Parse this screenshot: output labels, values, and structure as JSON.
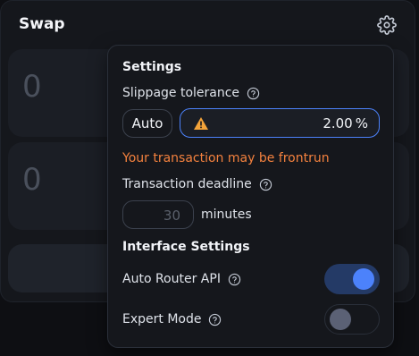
{
  "swap": {
    "title": "Swap",
    "input_amount": "0",
    "output_amount": "0"
  },
  "settings": {
    "title": "Settings",
    "slippage_label": "Slippage tolerance",
    "auto_label": "Auto",
    "slippage_value": "2.00",
    "slippage_unit": "%",
    "frontrun_warning": "Your transaction may be frontrun",
    "deadline_label": "Transaction deadline",
    "deadline_placeholder": "30",
    "deadline_unit": "minutes",
    "interface_title": "Interface Settings",
    "auto_router_label": "Auto Router API",
    "auto_router_enabled": true,
    "expert_mode_label": "Expert Mode",
    "expert_mode_enabled": false
  },
  "colors": {
    "accent": "#4c82fb",
    "warning": "#f3813e",
    "warning_icon": "#f3a33a"
  },
  "icons": [
    "gear-icon",
    "help-icon",
    "warning-icon"
  ]
}
